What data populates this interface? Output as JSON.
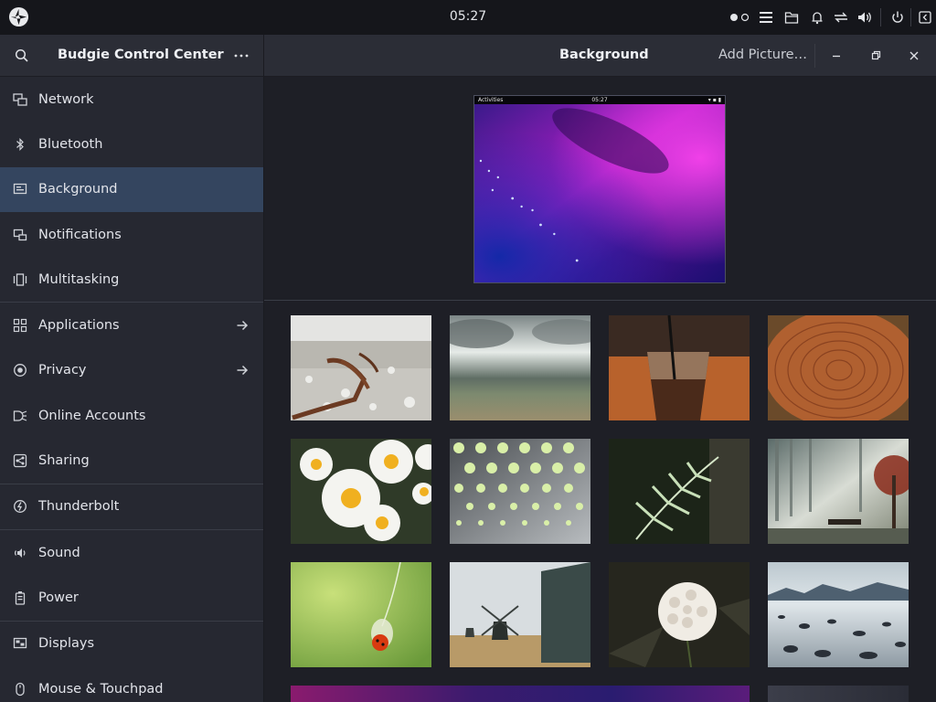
{
  "panel": {
    "clock": "05:27",
    "tray_icons": [
      "workspace-indicator-icon",
      "menu-icon",
      "folder-icon",
      "bell-icon",
      "network-transfer-icon",
      "volume-icon",
      "power-icon",
      "collapse-panel-icon"
    ]
  },
  "sidebar": {
    "title": "Budgie Control Center",
    "items": [
      {
        "label": "Network",
        "icon": "network-icon"
      },
      {
        "label": "Bluetooth",
        "icon": "bluetooth-icon"
      },
      {
        "label": "Background",
        "icon": "background-icon",
        "active": true
      },
      {
        "label": "Notifications",
        "icon": "notifications-icon"
      },
      {
        "label": "Multitasking",
        "icon": "multitasking-icon"
      },
      {
        "label": "Applications",
        "icon": "applications-icon",
        "has_arrow": true
      },
      {
        "label": "Privacy",
        "icon": "privacy-icon",
        "has_arrow": true
      },
      {
        "label": "Online Accounts",
        "icon": "online-accounts-icon"
      },
      {
        "label": "Sharing",
        "icon": "sharing-icon"
      },
      {
        "label": "Thunderbolt",
        "icon": "thunderbolt-icon"
      },
      {
        "label": "Sound",
        "icon": "sound-icon"
      },
      {
        "label": "Power",
        "icon": "power-icon"
      },
      {
        "label": "Displays",
        "icon": "displays-icon"
      },
      {
        "label": "Mouse & Touchpad",
        "icon": "mouse-icon"
      }
    ]
  },
  "main": {
    "title": "Background",
    "add_button": "Add Picture…",
    "preview": {
      "activities": "Activities",
      "time": "05:27"
    },
    "wallpapers": [
      "beach-anchor",
      "cloudy-sea",
      "iced-coffee",
      "wood-rings",
      "daisies",
      "perforated-metal",
      "fern",
      "misty-forest",
      "ladybug-dandelion",
      "windmills",
      "white-flower",
      "lake-stones",
      "desktop-screenshot",
      "dark-gradient"
    ]
  },
  "colors": {
    "accent": "#34455f",
    "panel": "#15161b",
    "sidebar": "#262831",
    "header": "#2b2d36",
    "main_bg": "#1e1f26"
  }
}
